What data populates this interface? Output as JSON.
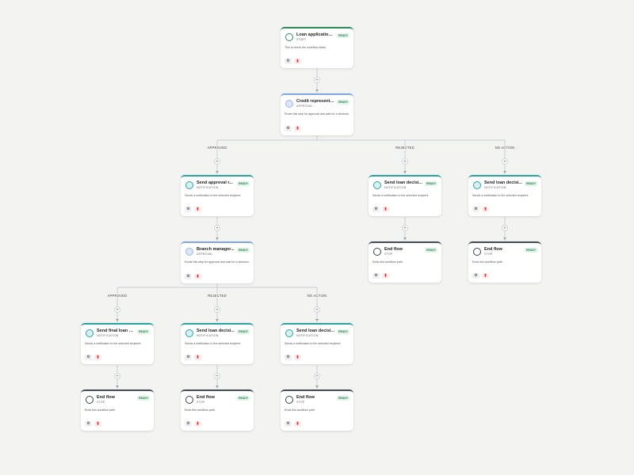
{
  "workflow": {
    "nodes": [
      {
        "id": "n1",
        "kind": "start",
        "title": "Loan application...",
        "type": "START",
        "badge": "READY",
        "desc": "This is where the workflow starts."
      },
      {
        "id": "n2",
        "kind": "approval",
        "title": "Credit representati...",
        "type": "APPROVAL",
        "badge": "READY",
        "desc": "Route this step for approval and wait for a decision."
      },
      {
        "id": "n3",
        "kind": "notification",
        "title": "Send approval r...",
        "type": "NOTIFICATION",
        "badge": "READY",
        "desc": "Sends a notification to the selected recipient."
      },
      {
        "id": "n4",
        "kind": "notification",
        "title": "Send loan decisi...",
        "type": "NOTIFICATION",
        "badge": "READY",
        "desc": "Sends a notification to the selected recipient."
      },
      {
        "id": "n5",
        "kind": "notification",
        "title": "Send loan decisi...",
        "type": "NOTIFICATION",
        "badge": "READY",
        "desc": "Sends a notification to the selected recipient."
      },
      {
        "id": "n6",
        "kind": "approval",
        "title": "Branch manager...",
        "type": "APPROVAL",
        "badge": "READY",
        "desc": "Route this step for approval and wait for a decision."
      },
      {
        "id": "n7",
        "kind": "stop",
        "title": "End flow",
        "type": "STOP",
        "badge": "READY",
        "desc": "Ends this workflow path."
      },
      {
        "id": "n8",
        "kind": "stop",
        "title": "End flow",
        "type": "STOP",
        "badge": "READY",
        "desc": "Ends this workflow path."
      },
      {
        "id": "n9",
        "kind": "notification",
        "title": "Send final loan d...",
        "type": "NOTIFICATION",
        "badge": "READY",
        "desc": "Sends a notification to the selected recipient."
      },
      {
        "id": "n10",
        "kind": "notification",
        "title": "Send loan decisi...",
        "type": "NOTIFICATION",
        "badge": "READY",
        "desc": "Sends a notification to the selected recipient."
      },
      {
        "id": "n11",
        "kind": "notification",
        "title": "Send loan decisi...",
        "type": "NOTIFICATION",
        "badge": "READY",
        "desc": "Sends a notification to the selected recipient."
      },
      {
        "id": "n12",
        "kind": "stop",
        "title": "End flow",
        "type": "STOP",
        "badge": "READY",
        "desc": "Ends this workflow path."
      },
      {
        "id": "n13",
        "kind": "stop",
        "title": "End flow",
        "type": "STOP",
        "badge": "READY",
        "desc": "Ends this workflow path."
      },
      {
        "id": "n14",
        "kind": "stop",
        "title": "End flow",
        "type": "STOP",
        "badge": "READY",
        "desc": "Ends this workflow path."
      }
    ],
    "branch_labels": [
      {
        "id": "b1",
        "text": "APPROVED"
      },
      {
        "id": "b2",
        "text": "REJECTED"
      },
      {
        "id": "b3",
        "text": "NO ACTION"
      },
      {
        "id": "b4",
        "text": "APPROVED"
      },
      {
        "id": "b5",
        "text": "REJECTED"
      },
      {
        "id": "b6",
        "text": "NO ACTION"
      }
    ],
    "add_step_symbol": "+",
    "gear_symbol": "⚙",
    "delete_symbol": "▮"
  },
  "colors": {
    "background": "#f3f4f2",
    "start": "#2e8b57",
    "approval": "#7fa7e0",
    "notification": "#2aa3a3",
    "stop": "#444c56",
    "ready_badge": "#2e7d4f"
  }
}
